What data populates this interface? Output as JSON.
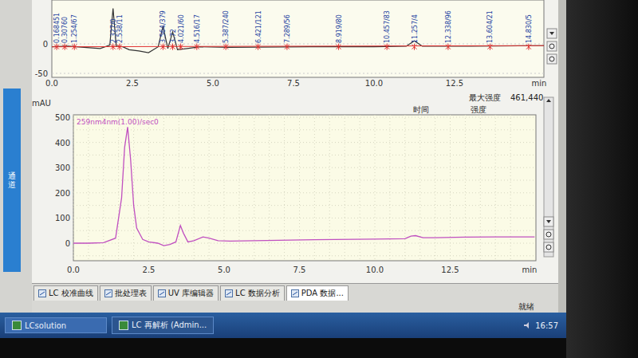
{
  "window": {
    "title": "LC 再解析"
  },
  "sidebar": {
    "label": "通道"
  },
  "top_chart": {
    "y_ticks": [
      "0",
      "-50"
    ],
    "x_ticks": [
      "0.0",
      "2.5",
      "5.0",
      "7.5",
      "10.0",
      "12.5"
    ],
    "x_unit": "min",
    "peaks": [
      {
        "time": 0.15,
        "label": "0.168451"
      },
      {
        "time": 0.4,
        "label": "0.30760"
      },
      {
        "time": 0.7,
        "label": "1.254/67"
      },
      {
        "time": 1.9,
        "label": "2.327/0"
      },
      {
        "time": 2.1,
        "label": "2.538/11"
      },
      {
        "time": 3.45,
        "label": "3.564/379"
      },
      {
        "time": 3.75,
        "label": "3.72"
      },
      {
        "time": 4.0,
        "label": "4.021/60"
      },
      {
        "time": 4.5,
        "label": "4.516/17"
      },
      {
        "time": 5.4,
        "label": "5.387/240"
      },
      {
        "time": 6.4,
        "label": "6.421/121"
      },
      {
        "time": 7.3,
        "label": "7.289/56"
      },
      {
        "time": 8.9,
        "label": "8.919/80"
      },
      {
        "time": 10.4,
        "label": "10.457/83"
      },
      {
        "time": 11.25,
        "label": "11.257/4"
      },
      {
        "time": 12.3,
        "label": "12.338/96"
      },
      {
        "time": 13.6,
        "label": "13.604/21"
      },
      {
        "time": 14.8,
        "label": "14.830/5"
      }
    ],
    "series": {
      "times": [
        0,
        0.5,
        1.0,
        1.5,
        1.8,
        1.9,
        2.0,
        2.2,
        2.4,
        2.7,
        3.0,
        3.3,
        3.45,
        3.6,
        3.75,
        3.9,
        4.2,
        4.6,
        5.5,
        8,
        10,
        11.0,
        11.25,
        11.5,
        13,
        15.3
      ],
      "values": [
        -5,
        -4,
        -6,
        -8,
        -2,
        60,
        -4,
        -5,
        -10,
        -12,
        -15,
        -5,
        30,
        -8,
        20,
        -10,
        -8,
        -5,
        -6,
        -5,
        -5,
        -4,
        5,
        -4,
        -4,
        -3
      ]
    }
  },
  "bottom_chart": {
    "title": "259nm4nm(1.00)/sec0",
    "y_unit": "mAU",
    "y_ticks": [
      "500",
      "400",
      "300",
      "200",
      "100",
      "0"
    ],
    "x_ticks": [
      "0.0",
      "2.5",
      "5.0",
      "7.5",
      "10.0",
      "12.5"
    ],
    "x_unit": "min",
    "max_label": "最大强度",
    "max_value": "461,440",
    "columns": [
      "时间",
      "强度"
    ],
    "series": {
      "times": [
        0,
        0.5,
        1.0,
        1.4,
        1.6,
        1.7,
        1.8,
        1.9,
        2.0,
        2.1,
        2.3,
        2.5,
        2.8,
        3.0,
        3.2,
        3.4,
        3.55,
        3.65,
        3.8,
        4.0,
        4.3,
        4.5,
        4.8,
        5.2,
        6,
        8,
        10,
        11.0,
        11.2,
        11.35,
        11.6,
        12,
        13,
        14,
        15.3
      ],
      "values": [
        0,
        0,
        2,
        20,
        180,
        380,
        461,
        330,
        150,
        60,
        15,
        5,
        0,
        -10,
        -5,
        5,
        70,
        40,
        5,
        10,
        25,
        20,
        10,
        8,
        10,
        14,
        16,
        18,
        28,
        30,
        22,
        22,
        24,
        25,
        25
      ]
    }
  },
  "tabs": [
    {
      "label": "LC 校准曲线",
      "selected": false
    },
    {
      "label": "批处理表",
      "selected": false
    },
    {
      "label": "UV 库编辑器",
      "selected": false
    },
    {
      "label": "LC 数据分析",
      "selected": false
    },
    {
      "label": "PDA 数据...",
      "selected": true
    }
  ],
  "status_bar": {
    "text": "就绪"
  },
  "taskbar": {
    "items": [
      {
        "label": "LCsolution",
        "active": false
      },
      {
        "label": "LC 再解析 (Admin...",
        "active": true
      }
    ],
    "clock": "16:57"
  }
}
